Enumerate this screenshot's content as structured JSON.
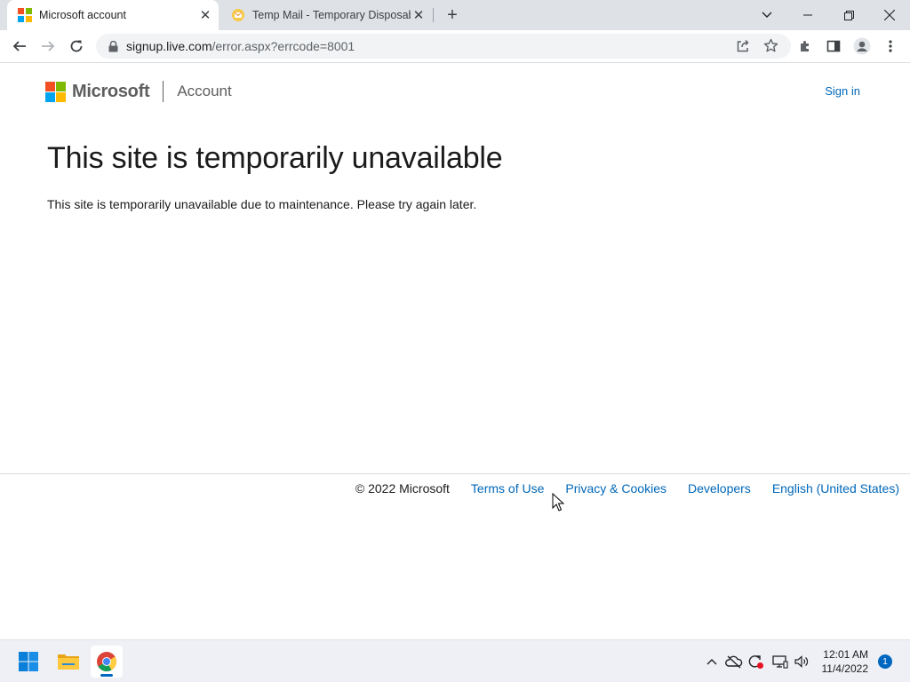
{
  "browser": {
    "tabs": [
      {
        "title": "Microsoft account",
        "favicon": "microsoft-logo-icon",
        "active": true
      },
      {
        "title": "Temp Mail - Temporary Disposab",
        "favicon": "temp-mail-icon",
        "active": false
      }
    ],
    "address": {
      "host": "signup.live.com",
      "path": "/error.aspx?errcode=8001"
    }
  },
  "header": {
    "brand": "Microsoft",
    "product": "Account",
    "sign_in": "Sign in"
  },
  "main": {
    "heading": "This site is temporarily unavailable",
    "message": "This site is temporarily unavailable due to maintenance. Please try again later."
  },
  "footer": {
    "copyright": "© 2022 Microsoft",
    "links": [
      "Terms of Use",
      "Privacy & Cookies",
      "Developers",
      "English (United States)"
    ]
  },
  "taskbar": {
    "apps": [
      "windows-start-icon",
      "file-explorer-icon",
      "chrome-icon"
    ],
    "time": "12:01 AM",
    "date": "11/4/2022",
    "notifications": "1"
  },
  "colors": {
    "ms_red": "#f25022",
    "ms_green": "#7fba00",
    "ms_blue": "#00a4ef",
    "ms_yellow": "#ffb900",
    "link": "#0067b8"
  }
}
